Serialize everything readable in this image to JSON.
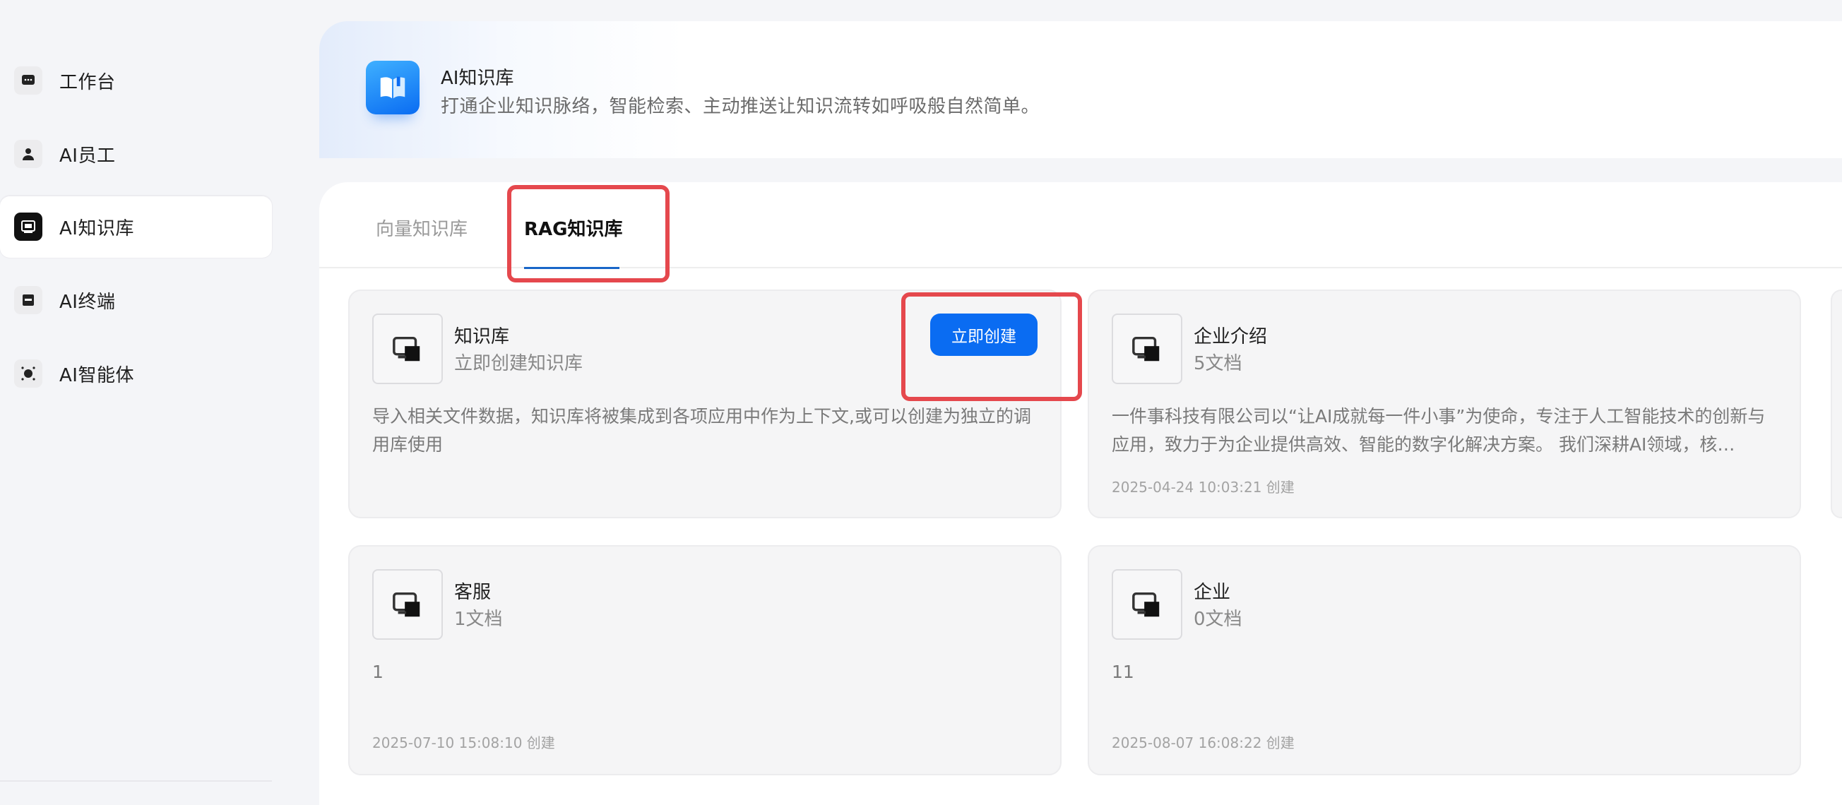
{
  "sidebar": {
    "items": [
      {
        "label": "工作台",
        "icon": "chat-icon",
        "active": false
      },
      {
        "label": "AI员工",
        "icon": "person-icon",
        "active": false
      },
      {
        "label": "AI知识库",
        "icon": "knowledge-icon",
        "active": true
      },
      {
        "label": "AI终端",
        "icon": "terminal-icon",
        "active": false
      },
      {
        "label": "AI智能体",
        "icon": "agent-icon",
        "active": false
      }
    ]
  },
  "header": {
    "title": "AI知识库",
    "subtitle": "打通企业知识脉络，智能检索、主动推送让知识流转如呼吸般自然简单。",
    "logo_icon": "book-icon"
  },
  "tabs": [
    {
      "label": "向量知识库",
      "active": false
    },
    {
      "label": "RAG知识库",
      "active": true
    }
  ],
  "cards": [
    {
      "title": "知识库",
      "subtitle": "立即创建知识库",
      "description": "导入相关文件数据，知识库将被集成到各项应用中作为上下文,或可以创建为独立的调用库使用",
      "button_label": "立即创建"
    },
    {
      "title": "企业介绍",
      "subtitle": "5文档",
      "description": "一件事科技有限公司以“让AI成就每一件小事”为使命，专注于人工智能技术的创新与应用，致力于为企业提供高效、智能的数字化解决方案。 我们深耕AI领域，核…",
      "date": "2025-04-24 10:03:21 创建"
    },
    {
      "title": "客服",
      "subtitle": "1文档",
      "description": "1",
      "date": "2025-07-10 15:08:10 创建"
    },
    {
      "title": "企业",
      "subtitle": "0文档",
      "description": "11",
      "date": "2025-08-07 16:08:22 创建"
    }
  ],
  "colors": {
    "accent": "#0a6cf2",
    "highlight": "#e5484d",
    "tab_underline": "#1966c8"
  }
}
